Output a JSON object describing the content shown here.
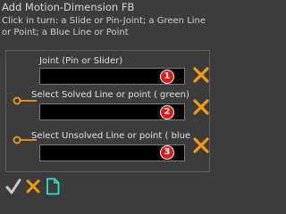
{
  "dialog": {
    "title": "Add Motion-Dimension FB",
    "instructions": "Click in turn: a Slide or Pin-Joint; a Green Line or Point; a Blue Line or Point"
  },
  "rows": [
    {
      "label": "Joint (Pin or Slider)",
      "value": "",
      "badge": "1",
      "icon": "none"
    },
    {
      "label": "Select Solved Line or point ( green)",
      "value": "",
      "badge": "2",
      "icon": "pin-joint-icon"
    },
    {
      "label": "Select Unsolved Line or point ( blue",
      "value": "",
      "badge": "3",
      "icon": "pin-joint-icon"
    }
  ],
  "colors": {
    "background": "#3c3c3c",
    "accent_orange": "#f39c12",
    "badge_red": "#e01919",
    "check_gray": "#c8c8c8",
    "new_doc_cyan": "#2ee0d0"
  },
  "toolbar": {
    "buttons": [
      "checkmark-icon",
      "cancel-x-icon",
      "new-document-icon"
    ]
  }
}
